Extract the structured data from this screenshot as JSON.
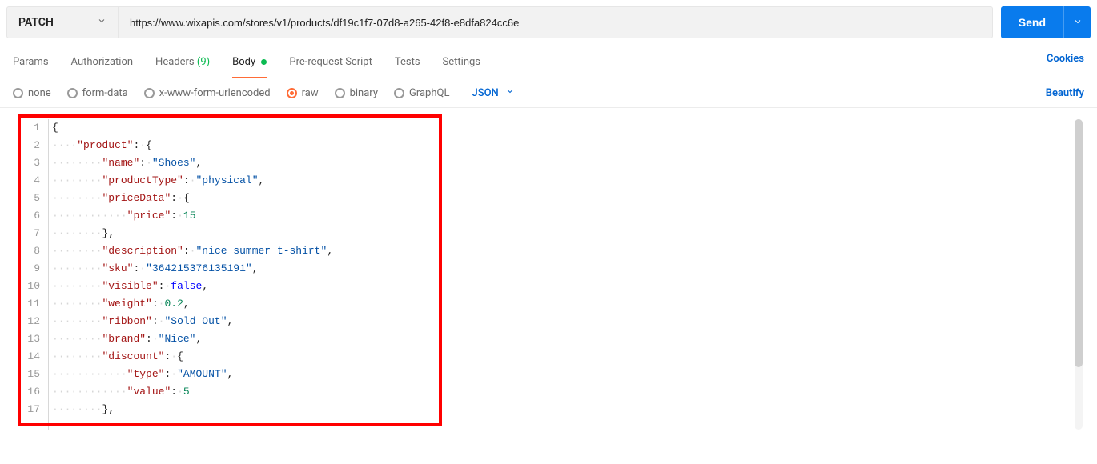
{
  "request": {
    "method": "PATCH",
    "url": "https://www.wixapis.com/stores/v1/products/df19c1f7-07d8-a265-42f8-e8dfa824cc6e",
    "send_label": "Send"
  },
  "tabs": {
    "params": "Params",
    "authorization": "Authorization",
    "headers_label": "Headers",
    "headers_count": "(9)",
    "body": "Body",
    "prerequest": "Pre-request Script",
    "tests": "Tests",
    "settings": "Settings",
    "cookies": "Cookies"
  },
  "body_options": {
    "none": "none",
    "form_data": "form-data",
    "urlencoded": "x-www-form-urlencoded",
    "raw": "raw",
    "binary": "binary",
    "graphql": "GraphQL",
    "content_type": "JSON",
    "beautify": "Beautify",
    "selected": "raw"
  },
  "editor": {
    "line_count": 17,
    "lines": [
      {
        "indent": 0,
        "tokens": [
          {
            "t": "punc",
            "v": "{"
          }
        ]
      },
      {
        "indent": 1,
        "tokens": [
          {
            "t": "key",
            "v": "\"product\""
          },
          {
            "t": "punc",
            "v": ": {"
          }
        ]
      },
      {
        "indent": 2,
        "tokens": [
          {
            "t": "key",
            "v": "\"name\""
          },
          {
            "t": "punc",
            "v": ": "
          },
          {
            "t": "str",
            "v": "\"Shoes\""
          },
          {
            "t": "punc",
            "v": ","
          }
        ]
      },
      {
        "indent": 2,
        "tokens": [
          {
            "t": "key",
            "v": "\"productType\""
          },
          {
            "t": "punc",
            "v": ": "
          },
          {
            "t": "str",
            "v": "\"physical\""
          },
          {
            "t": "punc",
            "v": ","
          }
        ]
      },
      {
        "indent": 2,
        "tokens": [
          {
            "t": "key",
            "v": "\"priceData\""
          },
          {
            "t": "punc",
            "v": ": {"
          }
        ]
      },
      {
        "indent": 3,
        "tokens": [
          {
            "t": "key",
            "v": "\"price\""
          },
          {
            "t": "punc",
            "v": ": "
          },
          {
            "t": "num",
            "v": "15"
          }
        ]
      },
      {
        "indent": 2,
        "tokens": [
          {
            "t": "punc",
            "v": "},"
          }
        ]
      },
      {
        "indent": 2,
        "tokens": [
          {
            "t": "key",
            "v": "\"description\""
          },
          {
            "t": "punc",
            "v": ": "
          },
          {
            "t": "str",
            "v": "\"nice summer t-shirt\""
          },
          {
            "t": "punc",
            "v": ","
          }
        ]
      },
      {
        "indent": 2,
        "tokens": [
          {
            "t": "key",
            "v": "\"sku\""
          },
          {
            "t": "punc",
            "v": ": "
          },
          {
            "t": "str",
            "v": "\"364215376135191\""
          },
          {
            "t": "punc",
            "v": ","
          }
        ]
      },
      {
        "indent": 2,
        "tokens": [
          {
            "t": "key",
            "v": "\"visible\""
          },
          {
            "t": "punc",
            "v": ": "
          },
          {
            "t": "kw",
            "v": "false"
          },
          {
            "t": "punc",
            "v": ","
          }
        ]
      },
      {
        "indent": 2,
        "tokens": [
          {
            "t": "key",
            "v": "\"weight\""
          },
          {
            "t": "punc",
            "v": ": "
          },
          {
            "t": "num",
            "v": "0.2"
          },
          {
            "t": "punc",
            "v": ","
          }
        ]
      },
      {
        "indent": 2,
        "tokens": [
          {
            "t": "key",
            "v": "\"ribbon\""
          },
          {
            "t": "punc",
            "v": ": "
          },
          {
            "t": "str",
            "v": "\"Sold Out\""
          },
          {
            "t": "punc",
            "v": ","
          }
        ]
      },
      {
        "indent": 2,
        "tokens": [
          {
            "t": "key",
            "v": "\"brand\""
          },
          {
            "t": "punc",
            "v": ": "
          },
          {
            "t": "str",
            "v": "\"Nice\""
          },
          {
            "t": "punc",
            "v": ","
          }
        ]
      },
      {
        "indent": 2,
        "tokens": [
          {
            "t": "key",
            "v": "\"discount\""
          },
          {
            "t": "punc",
            "v": ": {"
          }
        ]
      },
      {
        "indent": 3,
        "tokens": [
          {
            "t": "key",
            "v": "\"type\""
          },
          {
            "t": "punc",
            "v": ": "
          },
          {
            "t": "str",
            "v": "\"AMOUNT\""
          },
          {
            "t": "punc",
            "v": ","
          }
        ]
      },
      {
        "indent": 3,
        "tokens": [
          {
            "t": "key",
            "v": "\"value\""
          },
          {
            "t": "punc",
            "v": ": "
          },
          {
            "t": "num",
            "v": "5"
          }
        ]
      },
      {
        "indent": 2,
        "tokens": [
          {
            "t": "punc",
            "v": "},"
          }
        ]
      }
    ]
  }
}
